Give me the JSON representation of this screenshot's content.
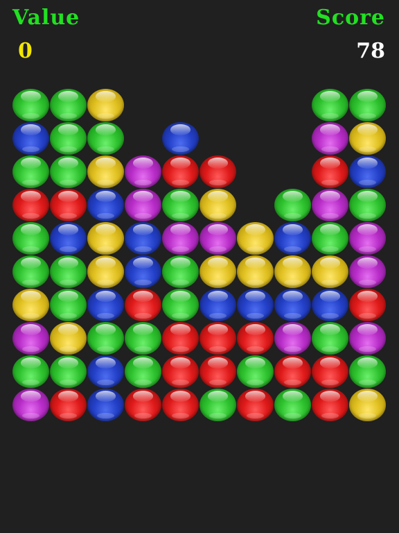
{
  "hud": {
    "value_label": "Value",
    "value": "0",
    "score_label": "Score",
    "score": "78"
  },
  "colors": {
    "hud_label": "#22e022",
    "value_number": "#f2e600",
    "score_number": "#ffffff",
    "background": "#202020"
  },
  "board": {
    "columns": 10,
    "rows": 10,
    "grid": [
      [
        "green",
        "green",
        "yellow",
        null,
        null,
        null,
        null,
        null,
        "green",
        "green"
      ],
      [
        "blue",
        "green",
        "green",
        null,
        "blue",
        null,
        null,
        null,
        "purple",
        "yellow"
      ],
      [
        "green",
        "green",
        "yellow",
        "purple",
        "red",
        "red",
        null,
        null,
        "red",
        "blue"
      ],
      [
        "red",
        "red",
        "blue",
        "purple",
        "green",
        "yellow",
        null,
        "green",
        "purple",
        "green"
      ],
      [
        "green",
        "blue",
        "yellow",
        "blue",
        "purple",
        "purple",
        "yellow",
        "blue",
        "green",
        "purple"
      ],
      [
        "green",
        "green",
        "yellow",
        "blue",
        "green",
        "yellow",
        "yellow",
        "yellow",
        "yellow",
        "purple"
      ],
      [
        "yellow",
        "green",
        "blue",
        "red",
        "green",
        "blue",
        "blue",
        "blue",
        "blue",
        "red"
      ],
      [
        "purple",
        "yellow",
        "green",
        "green",
        "red",
        "red",
        "red",
        "purple",
        "green",
        "purple"
      ],
      [
        "green",
        "green",
        "blue",
        "green",
        "red",
        "red",
        "green",
        "red",
        "red",
        "green"
      ],
      [
        "purple",
        "red",
        "blue",
        "red",
        "red",
        "green",
        "red",
        "green",
        "red",
        "yellow"
      ]
    ]
  }
}
